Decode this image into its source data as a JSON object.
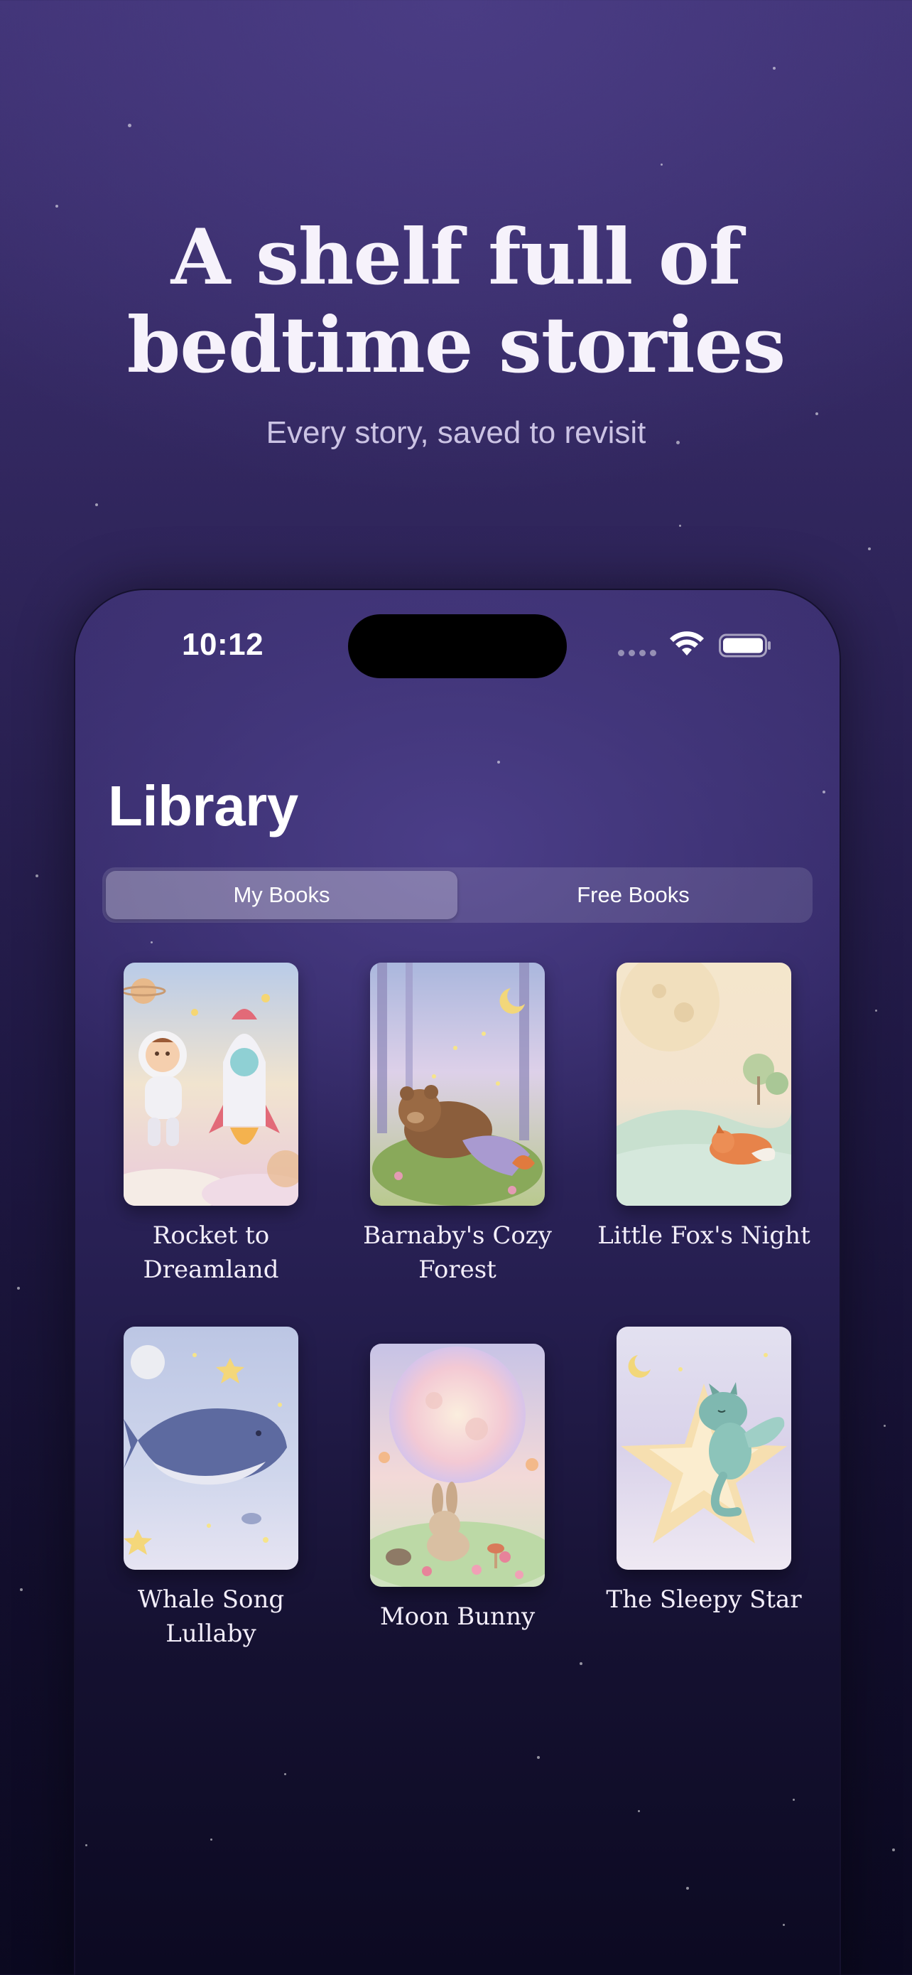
{
  "hero": {
    "title_line1": "A shelf full of",
    "title_line2": "bedtime stories",
    "subtitle": "Every story, saved to revisit"
  },
  "status_bar": {
    "time": "10:12"
  },
  "library": {
    "title": "Library",
    "tabs": [
      {
        "label": "My Books",
        "selected": true
      },
      {
        "label": "Free Books",
        "selected": false
      }
    ],
    "books": [
      {
        "title": "Rocket to Dreamland",
        "cover": "astronaut-rocket-illustration"
      },
      {
        "title": "Barnaby's Cozy Forest",
        "cover": "sleeping-bear-forest-illustration"
      },
      {
        "title": "Little Fox's Night",
        "cover": "sleeping-fox-moon-illustration"
      },
      {
        "title": "Whale Song Lullaby",
        "cover": "whale-night-sky-illustration"
      },
      {
        "title": "Moon Bunny",
        "cover": "bunny-full-moon-illustration"
      },
      {
        "title": "The Sleepy Star",
        "cover": "dragon-star-illustration"
      }
    ]
  },
  "colors": {
    "background_top": "#3f3274",
    "background_bottom": "#0b0920",
    "text_primary": "#ffffff",
    "text_secondary": "#cbc3e4"
  }
}
